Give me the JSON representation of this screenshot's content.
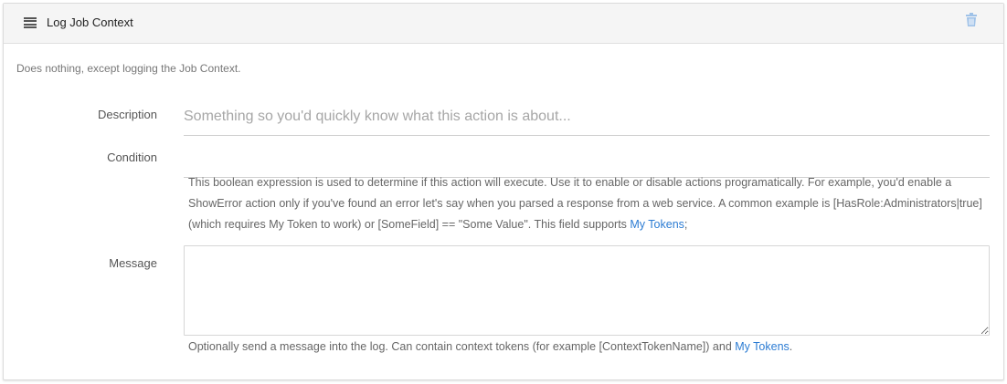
{
  "header": {
    "title": "Log Job Context",
    "menu_icon": "menu-icon",
    "delete_icon": "trash-icon",
    "accent_color": "#2c7cd3"
  },
  "summary": "Does nothing, except logging the Job Context.",
  "fields": {
    "description": {
      "label": "Description",
      "placeholder": "Something so you'd quickly know what this action is about...",
      "value": ""
    },
    "condition": {
      "label": "Condition",
      "value": "",
      "help_text": "This boolean expression is used to determine if this action will execute. Use it to enable or disable actions programatically. For example, you'd enable a ShowError action only if you've found an error let's say when you parsed a response from a web service. A common example is [HasRole:Administrators|true] (which requires My Token to work) or [SomeField] == \"Some Value\". This field supports ",
      "help_link": "My Tokens",
      "help_suffix": ";"
    },
    "message": {
      "label": "Message",
      "value": "",
      "help_text": "Optionally send a message into the log. Can contain context tokens (for example [ContextTokenName]) and ",
      "help_link": "My Tokens",
      "help_suffix": "."
    }
  }
}
